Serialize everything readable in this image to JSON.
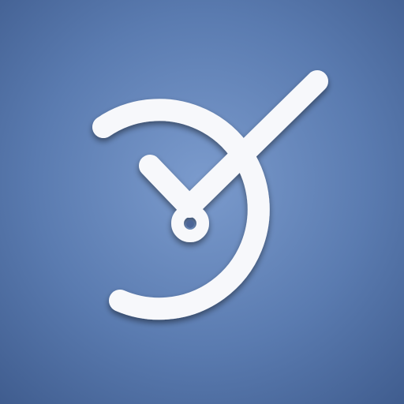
{
  "icon": {
    "name": "clock-checkmark-icon",
    "colors": {
      "background_center": "#7b9bcd",
      "background_mid": "#5a7bb0",
      "background_edge": "#3f5c8e",
      "glyph": "#f7f8fb",
      "glyph_shadow": "#1e3258"
    }
  }
}
